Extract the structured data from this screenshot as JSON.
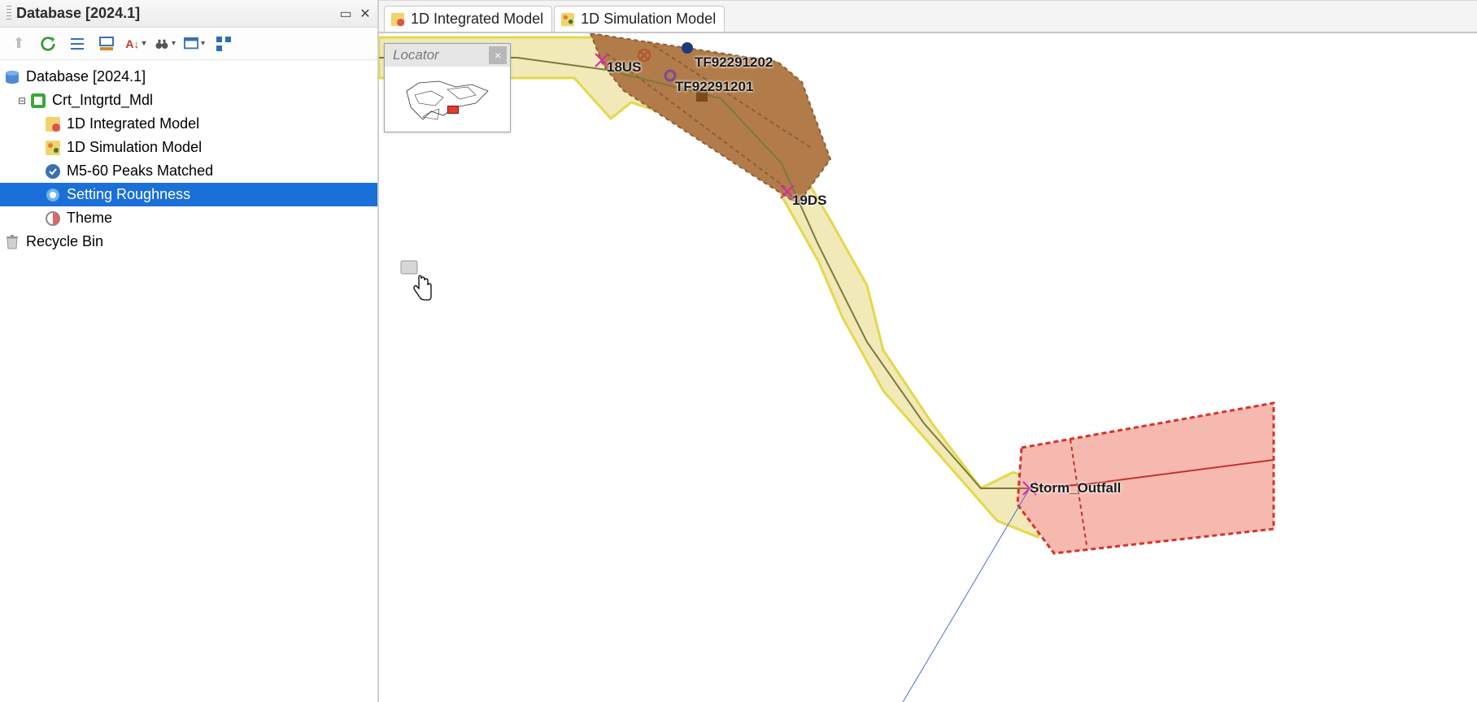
{
  "panel": {
    "title": "Database [2024.1]"
  },
  "tree": {
    "root": "Database [2024.1]",
    "group": "Crt_Intgrtd_Mdl",
    "items": [
      "1D Integrated Model",
      "1D Simulation Model",
      "M5-60 Peaks Matched",
      "Setting Roughness",
      "Theme"
    ],
    "recycle": "Recycle Bin"
  },
  "tabs": [
    "1D Integrated Model",
    "1D Simulation Model"
  ],
  "locator": {
    "title": "Locator"
  },
  "map_labels": {
    "n1": "18US",
    "n2": "TF92291202",
    "n3": "TF92291201",
    "n4": "19DS",
    "n5": "Storm_Outfall"
  }
}
